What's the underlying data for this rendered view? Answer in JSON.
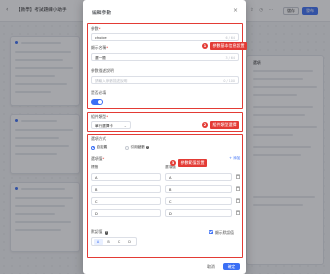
{
  "app": {
    "title": "【教學】考試題練小助手",
    "save_label": "儲存",
    "publish_label": "發布",
    "toolbar_icons": [
      "share-icon",
      "history-icon",
      "more-icon"
    ]
  },
  "right_panel": {
    "title": "選項"
  },
  "modal": {
    "title": "編輯參數",
    "close_icon": "close-icon",
    "param_name": {
      "label": "參數",
      "value": "choice",
      "count": "6 / 64"
    },
    "display_name": {
      "label": "顯示名稱",
      "value": "選一題",
      "count": "3 / 64"
    },
    "param_desc": {
      "label": "參數描述說明",
      "placeholder": "請輸入參數描述說明",
      "count": "0 / 100"
    },
    "required": {
      "label": "是否必填",
      "enabled": true
    },
    "component_type": {
      "label": "組件類型",
      "value": "單行選擇卡"
    },
    "option_mode": {
      "label": "選項方式",
      "custom_label": "自定義",
      "reference_label": "引用變數",
      "selected": "custom"
    },
    "options_section": {
      "label": "選項值",
      "add_label": "+ 添加",
      "col_label": "標籤",
      "col_value": "選項值",
      "rows": [
        {
          "label": "A",
          "value": "A"
        },
        {
          "label": "B",
          "value": "B"
        },
        {
          "label": "C",
          "value": "C"
        },
        {
          "label": "D",
          "value": "D"
        }
      ]
    },
    "default_value": {
      "label": "默認值",
      "chips": [
        "A",
        "B",
        "C",
        "D"
      ],
      "selected": "A",
      "show_default_label": "顯示默認值",
      "show_default_checked": true
    },
    "footer": {
      "cancel_label": "取消",
      "confirm_label": "確定"
    }
  },
  "annotations": {
    "accent": "#e33b35",
    "items": [
      {
        "num": "1",
        "text": "參數基本信息設置"
      },
      {
        "num": "2",
        "text": "組件類型選擇"
      },
      {
        "num": "3",
        "text": "參數範值設置"
      }
    ]
  },
  "colors": {
    "primary": "#3b6ff5",
    "annotation_red": "#e33b35"
  }
}
